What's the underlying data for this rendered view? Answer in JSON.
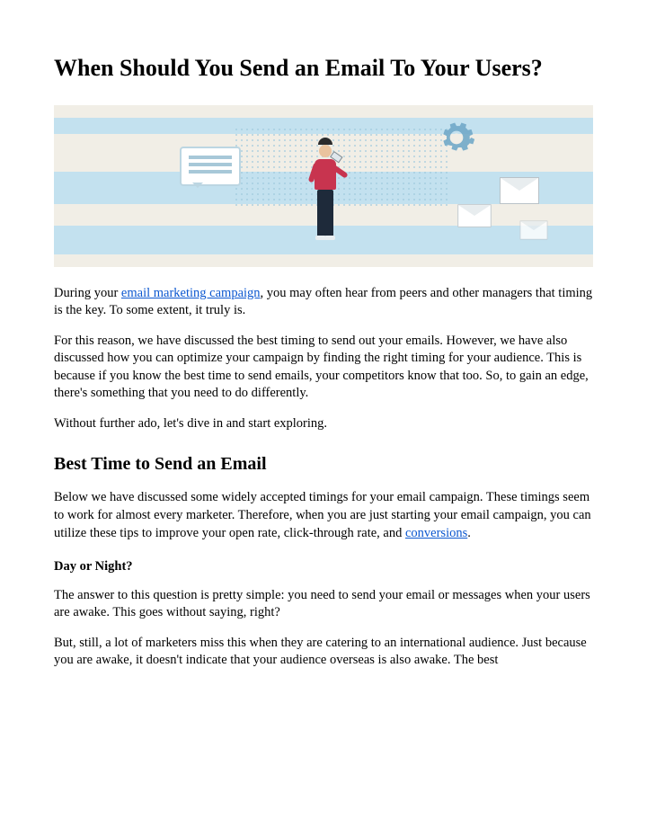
{
  "title": "When Should You Send an Email To Your Users?",
  "intro": {
    "before_link": "During your ",
    "link_text": "email marketing campaign",
    "after_link": ", you may often hear from peers and other managers that timing is the key. To some extent, it truly is."
  },
  "p2": "For this reason, we have discussed the best timing to send out your emails. However, we have also discussed how you can optimize your campaign by finding the right timing for your audience. This is because if you know the best time to send emails, your competitors know that too. So, to gain an edge, there's something that you need to do differently.",
  "p3": "Without further ado, let's dive in and start exploring.",
  "h2": "Best Time to Send an Email",
  "p4": {
    "before_link": "Below we have discussed some widely accepted timings for your email campaign. These timings seem to work for almost every marketer. Therefore, when you are just starting your email campaign, you can utilize these tips to improve your open rate, click-through rate, and ",
    "link_text": "conversions",
    "after_link": "."
  },
  "subhead": "Day or Night?",
  "p5": "The answer to this question is pretty simple: you need to send your email or messages when your users are awake. This goes without saying, right?",
  "p6": "But, still, a lot of marketers miss this when they are catering to an international audience. Just because you are awake, it doesn't indicate that your audience overseas is also awake. The best"
}
